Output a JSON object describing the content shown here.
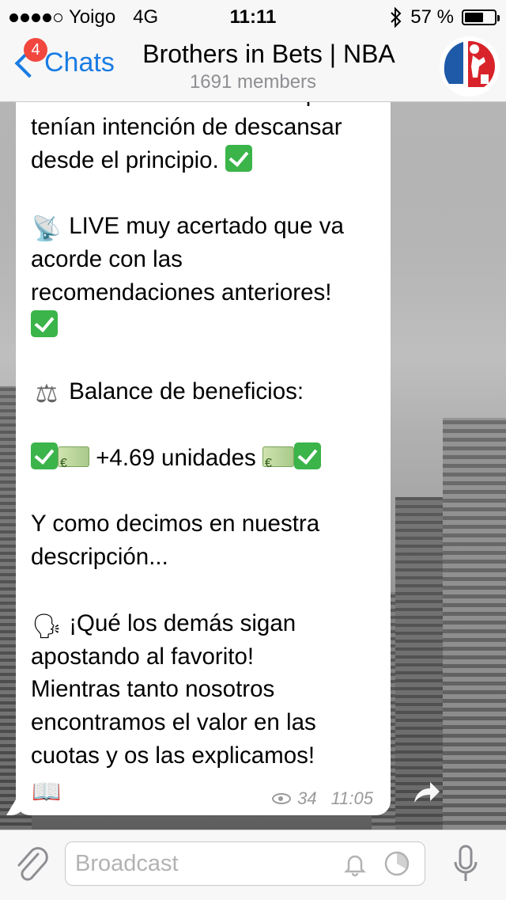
{
  "status_bar": {
    "carrier": "Yoigo",
    "network": "4G",
    "time": "11:11",
    "battery": "57 %"
  },
  "nav": {
    "back_label": "Chats",
    "unread_badge": "4",
    "title": "Brothers in Bets | NBA",
    "subtitle": "1691 members"
  },
  "message": {
    "lines": {
      "l0": "con unos Suns cansados que",
      "l1": "tenían intención de descansar",
      "l2": "desde el principio.",
      "l3": "LIVE muy acertado que va",
      "l4": "acorde con las",
      "l5": "recomendaciones anteriores!",
      "l6": "Balance de beneficios:",
      "l7": "+4.69 unidades",
      "l8": "Y como decimos en nuestra",
      "l9": "descripción...",
      "l10": "¡Qué los demás sigan",
      "l11": "apostando al favorito!",
      "l12": "Mientras tanto nosotros",
      "l13": "encontramos el valor en las",
      "l14": "cuotas y os las explicamos!"
    },
    "views": "34",
    "sent_time": "11:05"
  },
  "input": {
    "placeholder": "Broadcast"
  },
  "colors": {
    "accent": "#1a7ce4",
    "badge": "#f2473f",
    "check": "#3bb44a"
  },
  "icons": [
    "attach-icon",
    "bell-icon",
    "timer-icon",
    "mic-icon",
    "share-icon",
    "eye-icon",
    "back-chevron-icon"
  ]
}
